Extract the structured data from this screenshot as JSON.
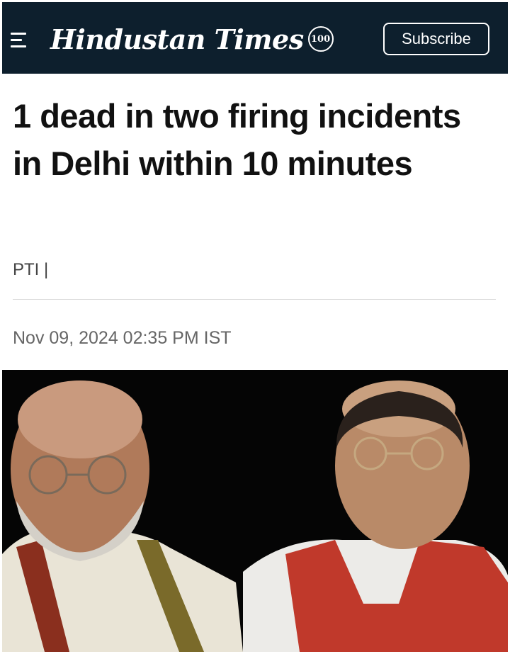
{
  "header": {
    "brand": "Hindustan Times",
    "badge": "100",
    "subscribe_label": "Subscribe"
  },
  "article": {
    "headline": "1 dead in two firing incidents in Delhi within 10 minutes",
    "byline": "PTI |",
    "timestamp": "Nov 09, 2024 02:35 PM IST"
  },
  "colors": {
    "header_bg": "#0d1f2d",
    "text": "#111111"
  },
  "icons": [
    "menu-icon",
    "hundred-years-badge-icon"
  ]
}
